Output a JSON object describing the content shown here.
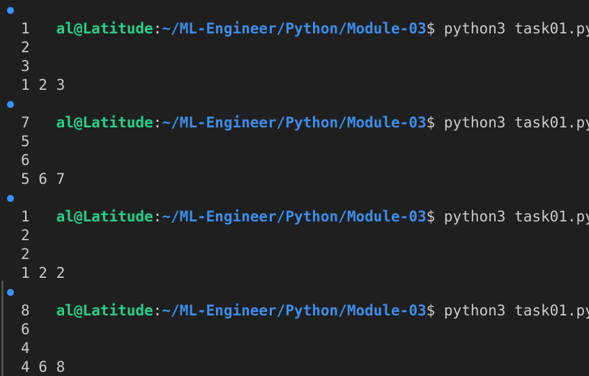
{
  "terminal": {
    "prompt": {
      "user": "al@Latitude",
      "separator": ":",
      "path": "~/ML-Engineer/Python/Module-03",
      "symbol": "$ ",
      "command": "python3 task01.py"
    },
    "runs": [
      {
        "outputs": [
          "1",
          "2",
          "3",
          "1 2 3"
        ]
      },
      {
        "outputs": [
          "7",
          "5",
          "6",
          "5 6 7"
        ]
      },
      {
        "outputs": [
          "1",
          "2",
          "2",
          "1 2 2"
        ]
      },
      {
        "outputs": [
          "8",
          "6",
          "4",
          "4 6 8"
        ]
      }
    ],
    "colors": {
      "background": "#1f1f1f",
      "user": "#23d18b",
      "path": "#3b8eea",
      "text": "#cccccc",
      "decoration": "#3794ff"
    }
  }
}
